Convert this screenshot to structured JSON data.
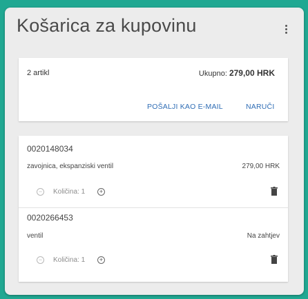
{
  "header": {
    "title": "Košarica za kupovinu",
    "menu_icon": "more-vert-icon"
  },
  "summary": {
    "item_count": "2 artikl",
    "total_label": "Ukupno:",
    "total_value": "279,00 HRK",
    "send_email_label": "POŠALJI KAO E-MAIL",
    "order_label": "NARUČI"
  },
  "items": [
    {
      "code": "0020148034",
      "description": "zavojnica, ekspanziski ventil",
      "price": "279,00 HRK",
      "quantity_label": "Količina: 1"
    },
    {
      "code": "0020266453",
      "description": "ventil",
      "price": "Na zahtjev",
      "quantity_label": "Količina: 1"
    }
  ],
  "colors": {
    "background": "#20a892",
    "panel": "#ececec",
    "link": "#2f6db5"
  }
}
